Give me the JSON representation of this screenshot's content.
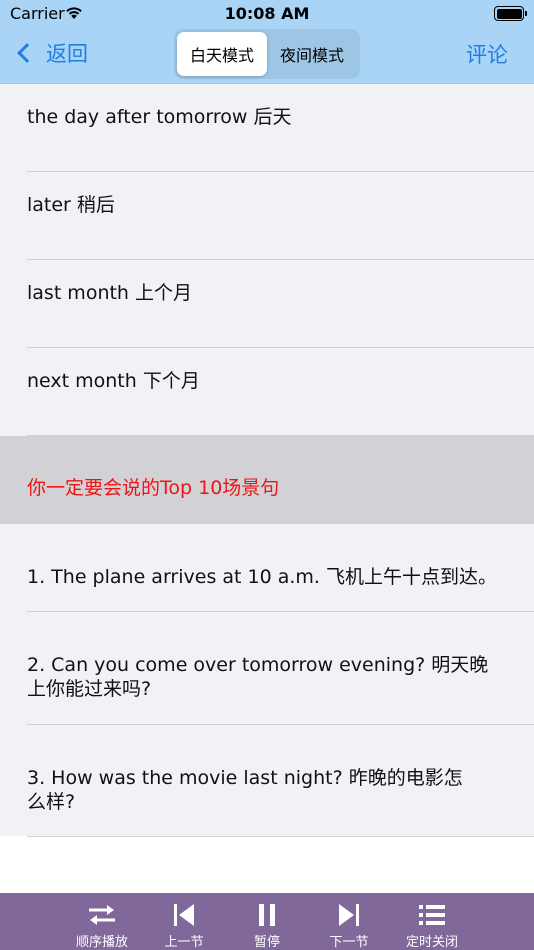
{
  "status_bar": {
    "carrier": "Carrier",
    "time": "10:08 AM"
  },
  "nav": {
    "back_label": "返回",
    "modes": [
      "白天模式",
      "夜间模式"
    ],
    "active_mode": "白天模式",
    "comment_label": "评论"
  },
  "list": {
    "rows": [
      {
        "text": "the day after tomorrow 后天",
        "type": "item"
      },
      {
        "text": "later 稍后",
        "type": "item"
      },
      {
        "text": "last month 上个月",
        "type": "item"
      },
      {
        "text": "next month 下个月",
        "type": "item"
      },
      {
        "text": "你一定要会说的Top 10场景句",
        "type": "section"
      },
      {
        "text": "1. The plane arrives at 10 a.m. 飞机上午十点到达。",
        "type": "item"
      },
      {
        "text": "2. Can you come over tomorrow evening? 明天晚上你能过来吗?",
        "type": "item"
      },
      {
        "text": "3. How was the movie last night? 昨晚的电影怎么样?",
        "type": "item"
      }
    ]
  },
  "player": {
    "order_label": "顺序播放",
    "prev_label": "上一节",
    "pause_label": "暂停",
    "next_label": "下一节",
    "timer_label": "定时关闭"
  },
  "colors": {
    "accent": "#1f7fe5",
    "nav_bg": "#a9d4f5",
    "player_bg": "#80689a",
    "section_text": "#ee1414"
  }
}
